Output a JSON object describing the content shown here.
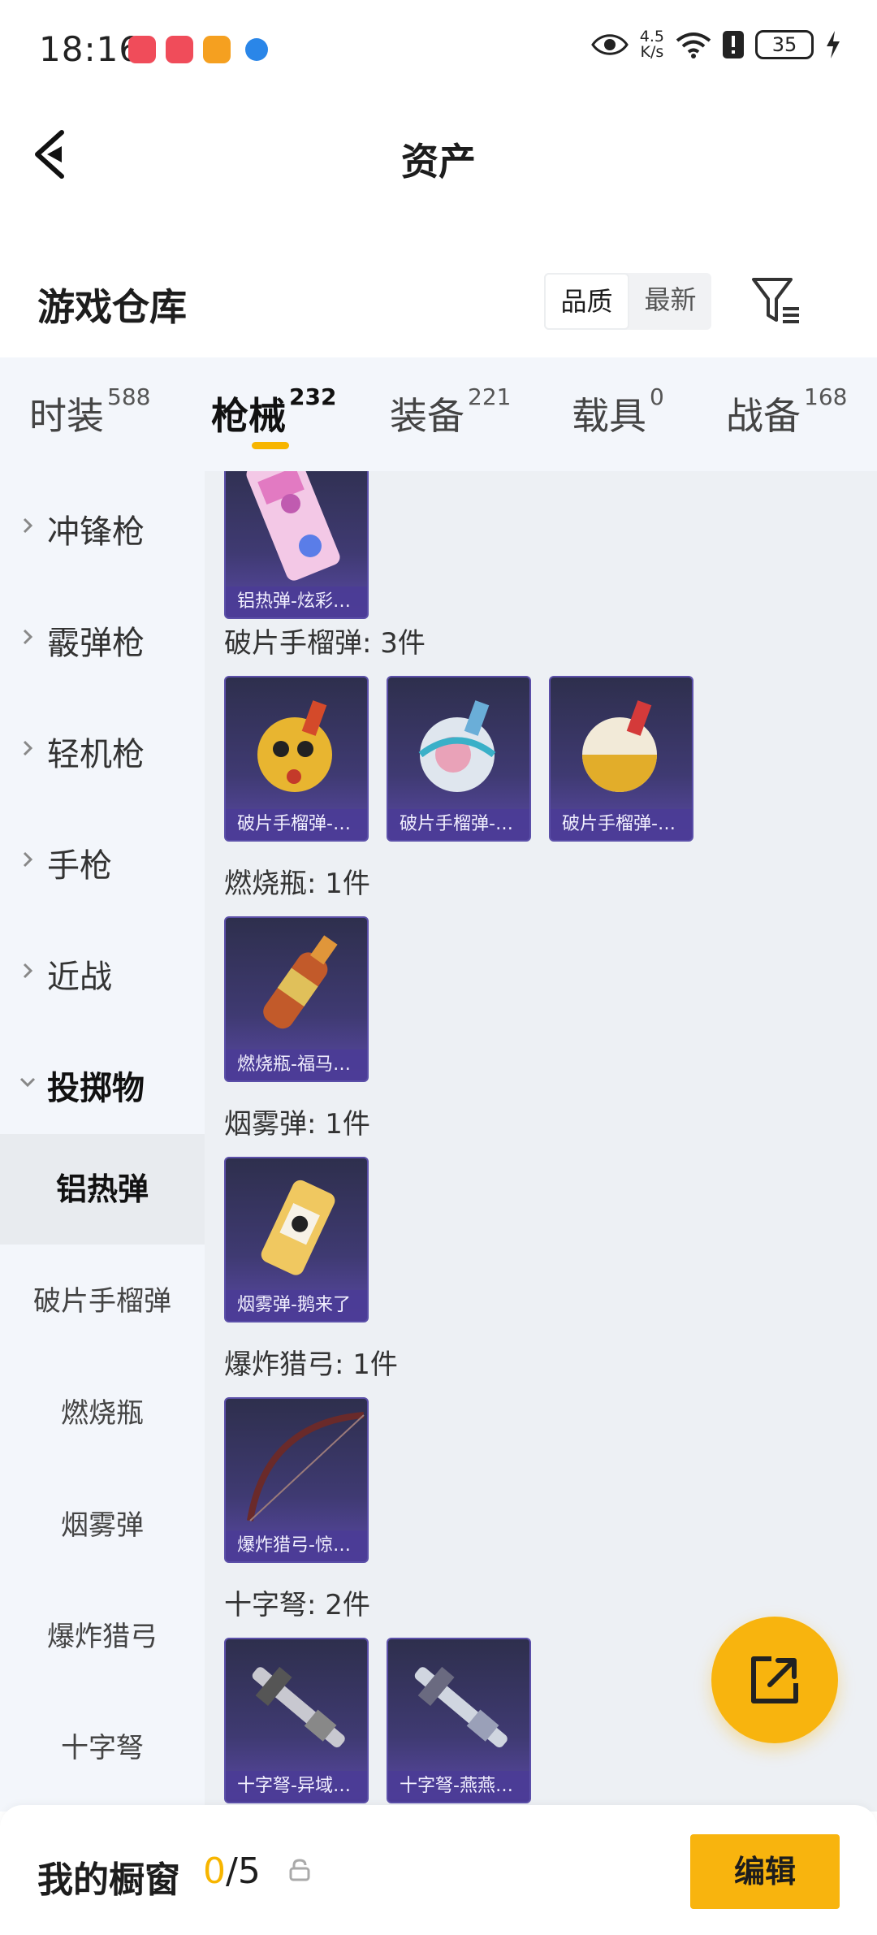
{
  "status_bar": {
    "time": "18:16",
    "net_speed_value": "4.5",
    "net_speed_unit": "K/s",
    "battery": "35"
  },
  "header": {
    "title": "资产"
  },
  "warehouse": {
    "title": "游戏仓库",
    "sort_options": [
      "品质",
      "最新"
    ],
    "sort_selected": "品质"
  },
  "tabs": [
    {
      "label": "时装",
      "count": "588"
    },
    {
      "label": "枪械",
      "count": "232"
    },
    {
      "label": "装备",
      "count": "221"
    },
    {
      "label": "载具",
      "count": "0"
    },
    {
      "label": "战备",
      "count": "168"
    }
  ],
  "active_tab": "枪械",
  "sidebar": {
    "groups": [
      "冲锋枪",
      "霰弹枪",
      "轻机枪",
      "手枪",
      "近战",
      "投掷物"
    ],
    "open_group": "投掷物",
    "subitems": [
      "铝热弹",
      "破片手榴弹",
      "燃烧瓶",
      "烟雾弹",
      "爆炸猎弓",
      "十字弩"
    ],
    "active_subitem": "铝热弹"
  },
  "sections": [
    {
      "title": "",
      "items": [
        "铝热弹-炫彩…"
      ]
    },
    {
      "title": "破片手榴弹: 3件",
      "items": [
        "破片手榴弹-…",
        "破片手榴弹-…",
        "破片手榴弹-…"
      ]
    },
    {
      "title": "燃烧瓶: 1件",
      "items": [
        "燃烧瓶-福马…"
      ]
    },
    {
      "title": "烟雾弹: 1件",
      "items": [
        "烟雾弹-鹅来了"
      ]
    },
    {
      "title": "爆炸猎弓: 1件",
      "items": [
        "爆炸猎弓-惊…"
      ]
    },
    {
      "title": "十字弩: 2件",
      "items": [
        "十字弩-异域…",
        "十字弩-燕燕…"
      ]
    }
  ],
  "bottom_bar": {
    "label": "我的橱窗",
    "used": "0",
    "total": "/5",
    "edit_label": "编辑"
  },
  "icons": {
    "back": "chevron-left-icon",
    "filter": "filter-icon",
    "share": "share-external-icon",
    "lock": "lock-icon",
    "eye": "eye-icon",
    "wifi": "wifi-icon"
  },
  "colors": {
    "accent": "#f8b40e",
    "tab_bg": "#f3f6fb",
    "content_bg": "#edf0f4",
    "card_bg": "#3f3a72"
  }
}
